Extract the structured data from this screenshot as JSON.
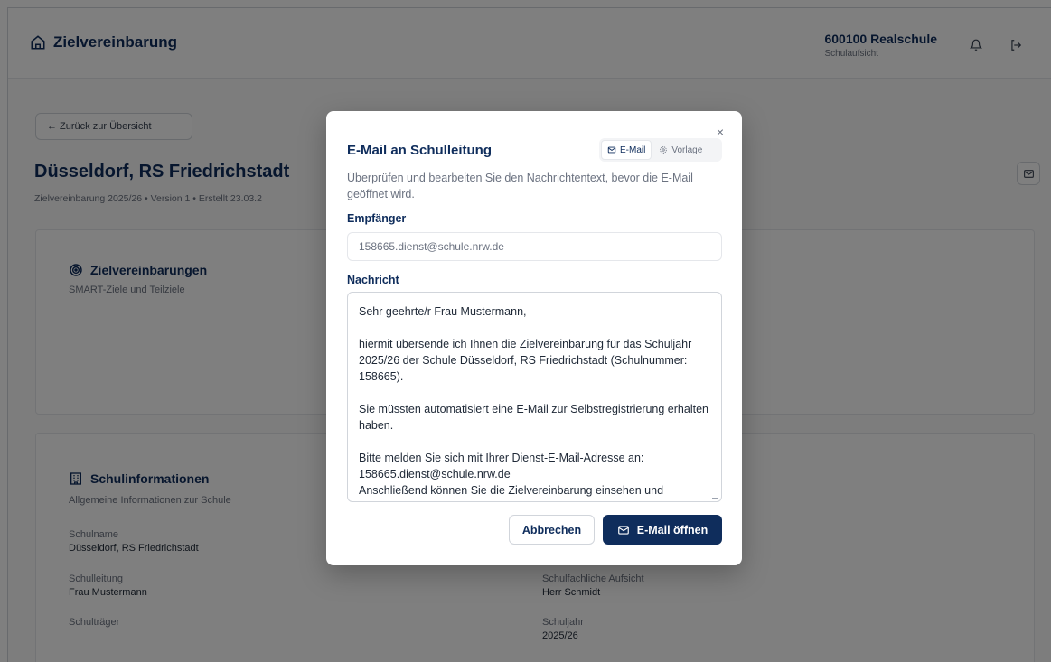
{
  "header": {
    "app_title": "Zielvereinbarung",
    "school_name": "600100 Realschule",
    "role": "Schulaufsicht"
  },
  "page": {
    "back_label": "← Zurück zur Übersicht",
    "school_title": "Düsseldorf, RS Friedrichstadt",
    "meta": "Zielvereinbarung 2025/26 • Version 1 • Erstellt 23.03.2"
  },
  "goals_card": {
    "title": "Zielvereinbarungen",
    "subtitle": "SMART-Ziele und Teilziele"
  },
  "info_card": {
    "title": "Schulinformationen",
    "subtitle": "Allgemeine Informationen zur Schule",
    "fields": [
      {
        "label": "Schulname",
        "value": "Düsseldorf, RS Friedrichstadt"
      },
      {
        "label": "Schulleitung",
        "value": "Frau Mustermann"
      },
      {
        "label": "Schulträger",
        "value": ""
      },
      {
        "label": "Schulfachliche Aufsicht",
        "value": "Herr Schmidt"
      },
      {
        "label": "Schuljahr",
        "value": "2025/26"
      }
    ]
  },
  "modal": {
    "title": "E-Mail an Schulleitung",
    "close": "×",
    "tabs": [
      "E-Mail",
      "Vorlage"
    ],
    "active_tab": "E-Mail",
    "description": "Überprüfen und bearbeiten Sie den Nachrichtentext, bevor die E-Mail geöffnet wird.",
    "recipient_label": "Empfänger",
    "recipient_value": "158665.dienst@schule.nrw.de",
    "message_label": "Nachricht",
    "message_paragraphs": [
      "Sehr geehrte/r Frau Mustermann,",
      "hiermit übersende ich Ihnen die Zielvereinbarung für das Schuljahr 2025/26 der Schule Düsseldorf, RS Friedrichstadt (Schulnummer: 158665).",
      "Sie müssten automatisiert eine E-Mail zur Selbstregistrierung erhalten haben.",
      "Bitte melden Sie sich mit Ihrer Dienst-E-Mail-Adresse an: 158665.dienst@schule.nrw.de\nAnschließend können Sie die Zielvereinbarung einsehen und bearbeiten."
    ],
    "cancel_label": "Abbrechen",
    "open_label": "E-Mail öffnen"
  },
  "colors": {
    "primary": "#0f2d5c",
    "overlay": "rgba(0,0,0,0.5)"
  },
  "icons": [
    "home-icon",
    "bell-icon",
    "logout-icon",
    "mail-icon",
    "target-icon",
    "building-icon",
    "close-icon",
    "settings-icon"
  ]
}
